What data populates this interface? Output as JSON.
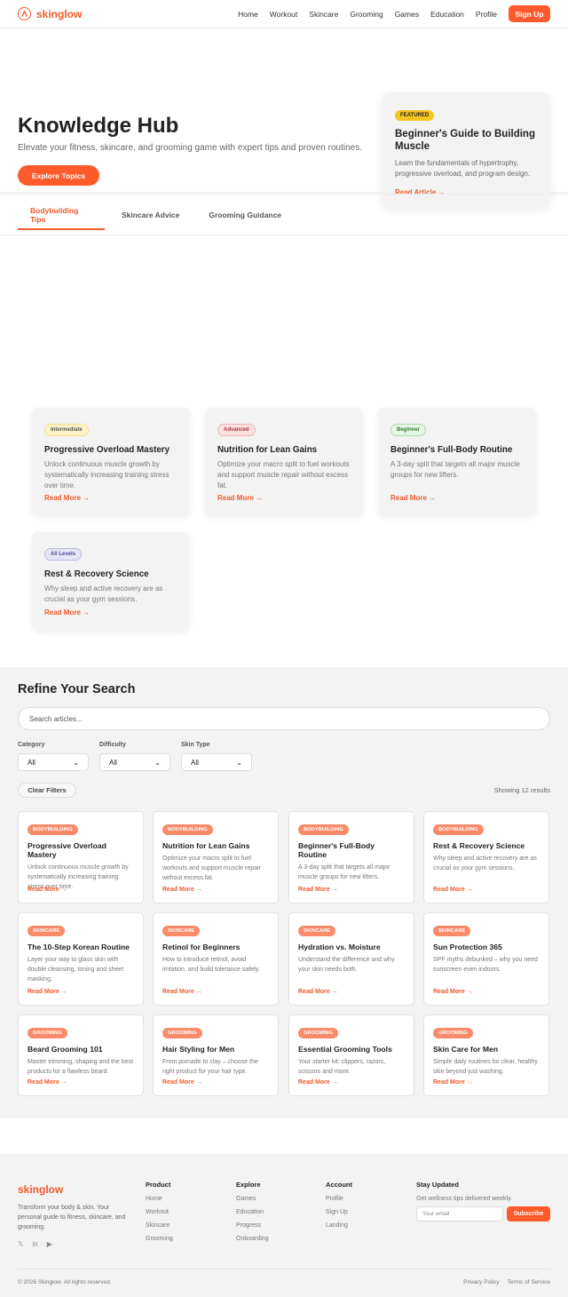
{
  "nav": {
    "brand": "skinglow",
    "links": [
      "Home",
      "Workout",
      "Skincare",
      "Grooming",
      "Games",
      "Education",
      "Profile"
    ],
    "signup_label": "Sign Up"
  },
  "hero": {
    "title": "Knowledge Hub",
    "subtitle": "Elevate your fitness, skincare, and grooming game with expert tips and proven routines.",
    "cta_label": "Explore Topics",
    "featured": {
      "badge": "FEATURED",
      "title": "Beginner's Guide to Building Muscle",
      "description": "Learn the fundamentals of hypertrophy, progressive overload, and program design.",
      "link": "Read Article →"
    }
  },
  "tabs": [
    "Bodybuilding Tips",
    "Skincare Advice",
    "Grooming Guidance"
  ],
  "tips": [
    {
      "badge": "Intermediate",
      "title": "Progressive Overload Mastery",
      "description": "Unlock continuous muscle growth by systematically increasing training stress over time.",
      "link": "Read More →"
    },
    {
      "badge": "Advanced",
      "title": "Nutrition for Lean Gains",
      "description": "Optimize your macro split to fuel workouts and support muscle repair without excess fat.",
      "link": "Read More →"
    },
    {
      "badge": "Beginner",
      "title": "Beginner's Full-Body Routine",
      "description": "A 3-day split that targets all major muscle groups for new lifters.",
      "link": "Read More →"
    },
    {
      "badge": "All Levels",
      "title": "Rest & Recovery Science",
      "description": "Why sleep and active recovery are as crucial as your gym sessions.",
      "link": "Read More →"
    }
  ],
  "refine": {
    "title": "Refine Your Search",
    "search_placeholder": "Search articles...",
    "filters": [
      {
        "label": "Category",
        "value": "All"
      },
      {
        "label": "Difficulty",
        "value": "All"
      },
      {
        "label": "Skin Type",
        "value": "All"
      }
    ],
    "clear_label": "Clear Filters",
    "showing": "Showing 12 results"
  },
  "articles": [
    {
      "badge": "BODYBUILDING",
      "title": "Progressive Overload Mastery",
      "description": "Unlock continuous muscle growth by systematically increasing training stress over time.",
      "link": "Read More →"
    },
    {
      "badge": "BODYBUILDING",
      "title": "Nutrition for Lean Gains",
      "description": "Optimize your macro split to fuel workouts and support muscle repair without excess fat.",
      "link": "Read More →"
    },
    {
      "badge": "BODYBUILDING",
      "title": "Beginner's Full-Body Routine",
      "description": "A 3-day split that targets all major muscle groups for new lifters.",
      "link": "Read More →"
    },
    {
      "badge": "BODYBUILDING",
      "title": "Rest & Recovery Science",
      "description": "Why sleep and active recovery are as crucial as your gym sessions.",
      "link": "Read More →"
    },
    {
      "badge": "SKINCARE",
      "title": "The 10-Step Korean Routine",
      "description": "Layer your way to glass skin with double cleansing, toning and sheet masking.",
      "link": "Read More →"
    },
    {
      "badge": "SKINCARE",
      "title": "Retinol for Beginners",
      "description": "How to introduce retinol, avoid irritation, and build tolerance safely.",
      "link": "Read More →"
    },
    {
      "badge": "SKINCARE",
      "title": "Hydration vs. Moisture",
      "description": "Understand the difference and why your skin needs both.",
      "link": "Read More →"
    },
    {
      "badge": "SKINCARE",
      "title": "Sun Protection 365",
      "description": "SPF myths debunked – why you need sunscreen even indoors.",
      "link": "Read More →"
    },
    {
      "badge": "GROOMING",
      "title": "Beard Grooming 101",
      "description": "Master trimming, shaping and the best products for a flawless beard.",
      "link": "Read More →"
    },
    {
      "badge": "GROOMING",
      "title": "Hair Styling for Men",
      "description": "From pomade to clay – choose the right product for your hair type.",
      "link": "Read More →"
    },
    {
      "badge": "GROOMING",
      "title": "Essential Grooming Tools",
      "description": "Your starter kit: clippers, razors, scissors and more.",
      "link": "Read More →"
    },
    {
      "badge": "GROOMING",
      "title": "Skin Care for Men",
      "description": "Simple daily routines for clear, healthy skin beyond just washing.",
      "link": "Read More →"
    }
  ],
  "footer": {
    "brand": "skinglow",
    "tagline": "Transform your body & skin. Your personal guide to fitness, skincare, and grooming.",
    "social": [
      "𝕏",
      "in",
      "▶"
    ],
    "columns": [
      {
        "title": "Product",
        "items": [
          "Home",
          "Workout",
          "Skincare",
          "Grooming"
        ]
      },
      {
        "title": "Explore",
        "items": [
          "Games",
          "Education",
          "Progress",
          "Onboarding"
        ]
      },
      {
        "title": "Account",
        "items": [
          "Profile",
          "Sign Up",
          "Landing"
        ]
      }
    ],
    "newsletter": {
      "title": "Stay Updated",
      "text": "Get wellness tips delivered weekly.",
      "placeholder": "Your email",
      "button": "Subscribe"
    },
    "copyright": "© 2026 Skinglow. All rights reserved.",
    "legal": [
      "Privacy Policy",
      "Terms of Service"
    ]
  },
  "colors": {
    "accent": "#ff5a2c",
    "badge_intermediate": "#fdf3c8",
    "badge_advanced": "#fde0e0",
    "badge_beginner": "#e3f6e3",
    "badge_all_levels": "#e6e6f8"
  }
}
